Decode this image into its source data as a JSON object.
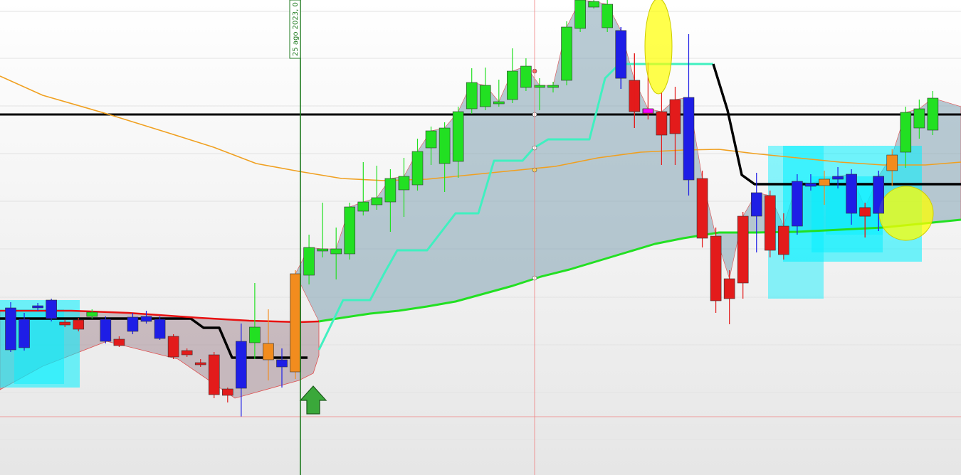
{
  "chart_data": {
    "type": "candlestick",
    "title": "",
    "xlabel": "",
    "ylabel": "",
    "grid": true,
    "legend": "none",
    "ylim": [
      0,
      668
    ],
    "date_marker": {
      "label": "25 ago 2023, 0",
      "index": 19
    },
    "candles": [
      {
        "i": 0,
        "o": 433,
        "c": 492,
        "h": 425,
        "l": 495,
        "color": "#1e1ee6"
      },
      {
        "i": 1,
        "o": 449,
        "c": 489,
        "h": 440,
        "l": 493,
        "color": "#1e1ee6"
      },
      {
        "i": 2,
        "o": 430,
        "c": 433,
        "h": 426,
        "l": 437,
        "color": "#1e1ee6"
      },
      {
        "i": 3,
        "o": 422,
        "c": 448,
        "h": 420,
        "l": 452,
        "color": "#1e1ee6"
      },
      {
        "i": 4,
        "o": 453,
        "c": 457,
        "h": 450,
        "l": 460,
        "color": "#e31b1b"
      },
      {
        "i": 5,
        "o": 450,
        "c": 463,
        "h": 447,
        "l": 466,
        "color": "#e31b1b"
      },
      {
        "i": 6,
        "o": 445,
        "c": 439,
        "h": 435,
        "l": 448,
        "color": "#22e022"
      },
      {
        "i": 7,
        "o": 449,
        "c": 480,
        "h": 445,
        "l": 483,
        "color": "#1e1ee6"
      },
      {
        "i": 8,
        "o": 477,
        "c": 486,
        "h": 473,
        "l": 488,
        "color": "#e31b1b"
      },
      {
        "i": 9,
        "o": 446,
        "c": 466,
        "h": 440,
        "l": 470,
        "color": "#1e1ee6"
      },
      {
        "i": 10,
        "o": 445,
        "c": 452,
        "h": 437,
        "l": 455,
        "color": "#1e1ee6"
      },
      {
        "i": 11,
        "o": 449,
        "c": 476,
        "h": 445,
        "l": 478,
        "color": "#1e1ee6"
      },
      {
        "i": 12,
        "o": 473,
        "c": 502,
        "h": 470,
        "l": 505,
        "color": "#e31b1b"
      },
      {
        "i": 13,
        "o": 493,
        "c": 499,
        "h": 490,
        "l": 502,
        "color": "#e31b1b"
      },
      {
        "i": 14,
        "o": 510,
        "c": 513,
        "h": 505,
        "l": 516,
        "color": "#e31b1b"
      },
      {
        "i": 15,
        "o": 499,
        "c": 555,
        "h": 495,
        "l": 560,
        "color": "#e31b1b"
      },
      {
        "i": 16,
        "o": 547,
        "c": 556,
        "h": 545,
        "l": 566,
        "color": "#e31b1b"
      },
      {
        "i": 17,
        "o": 480,
        "c": 546,
        "h": 455,
        "l": 586,
        "color": "#1e1ee6"
      },
      {
        "i": 18,
        "o": 482,
        "c": 460,
        "h": 398,
        "l": 505,
        "color": "#22e022"
      },
      {
        "i": 19,
        "o": 483,
        "c": 506,
        "h": 435,
        "l": 535,
        "color": "#f28c1e"
      },
      {
        "i": 20,
        "o": 506,
        "c": 516,
        "h": 490,
        "l": 545,
        "color": "#1e1ee6"
      },
      {
        "i": 21,
        "o": 523,
        "c": 385,
        "h": 380,
        "l": 533,
        "color": "#f28c1e"
      },
      {
        "i": 22,
        "o": 387,
        "c": 348,
        "h": 330,
        "l": 400,
        "color": "#22e022"
      },
      {
        "i": 23,
        "o": 352,
        "c": 350,
        "h": 285,
        "l": 362,
        "color": "#22e022"
      },
      {
        "i": 24,
        "o": 357,
        "c": 350,
        "h": 320,
        "l": 393,
        "color": "#22e022"
      },
      {
        "i": 25,
        "o": 357,
        "c": 291,
        "h": 285,
        "l": 365,
        "color": "#22e022"
      },
      {
        "i": 26,
        "o": 297,
        "c": 284,
        "h": 228,
        "l": 303,
        "color": "#22e022"
      },
      {
        "i": 27,
        "o": 288,
        "c": 278,
        "h": 233,
        "l": 295,
        "color": "#22e022"
      },
      {
        "i": 28,
        "o": 284,
        "c": 251,
        "h": 238,
        "l": 326,
        "color": "#22e022"
      },
      {
        "i": 29,
        "o": 267,
        "c": 248,
        "h": 222,
        "l": 305,
        "color": "#22e022"
      },
      {
        "i": 30,
        "o": 260,
        "c": 213,
        "h": 195,
        "l": 268,
        "color": "#22e022"
      },
      {
        "i": 31,
        "o": 208,
        "c": 184,
        "h": 178,
        "l": 232,
        "color": "#22e022"
      },
      {
        "i": 32,
        "o": 230,
        "c": 180,
        "h": 172,
        "l": 270,
        "color": "#22e022"
      },
      {
        "i": 33,
        "o": 227,
        "c": 157,
        "h": 150,
        "l": 250,
        "color": "#22e022"
      },
      {
        "i": 34,
        "o": 153,
        "c": 116,
        "h": 96,
        "l": 160,
        "color": "#22e022"
      },
      {
        "i": 35,
        "o": 150,
        "c": 120,
        "h": 95,
        "l": 155,
        "color": "#22e022"
      },
      {
        "i": 36,
        "o": 146,
        "c": 143,
        "h": 112,
        "l": 150,
        "color": "#22e022"
      },
      {
        "i": 37,
        "o": 140,
        "c": 100,
        "h": 68,
        "l": 145,
        "color": "#22e022"
      },
      {
        "i": 38,
        "o": 123,
        "c": 93,
        "h": 82,
        "l": 128,
        "color": "#22e022"
      },
      {
        "i": 39,
        "o": 123,
        "c": 120,
        "h": 110,
        "l": 155,
        "color": "#22e022"
      },
      {
        "i": 40,
        "o": 123,
        "c": 120,
        "h": 115,
        "l": 130,
        "color": "#22e022"
      },
      {
        "i": 41,
        "o": 113,
        "c": 38,
        "h": 30,
        "l": 120,
        "color": "#22e022"
      },
      {
        "i": 42,
        "o": 40,
        "c": 0,
        "h": 0,
        "l": 45,
        "color": "#22e022"
      },
      {
        "i": 43,
        "o": 10,
        "c": 2,
        "h": 0,
        "l": 12,
        "color": "#22e022"
      },
      {
        "i": 44,
        "o": 39,
        "c": 6,
        "h": 0,
        "l": 45,
        "color": "#22e022"
      },
      {
        "i": 45,
        "o": 43,
        "c": 110,
        "h": 38,
        "l": 125,
        "color": "#1e1ee6"
      },
      {
        "i": 46,
        "o": 113,
        "c": 157,
        "h": 75,
        "l": 180,
        "color": "#e31b1b"
      },
      {
        "i": 47,
        "o": 153,
        "c": 160,
        "h": 88,
        "l": 168,
        "color": "#e31b1b"
      },
      {
        "i": 48,
        "o": 157,
        "c": 190,
        "h": 130,
        "l": 232,
        "color": "#e31b1b"
      },
      {
        "i": 49,
        "o": 140,
        "c": 188,
        "h": 122,
        "l": 232,
        "color": "#e31b1b"
      },
      {
        "i": 50,
        "o": 137,
        "c": 253,
        "h": 48,
        "l": 275,
        "color": "#1e1ee6"
      },
      {
        "i": 51,
        "o": 251,
        "c": 335,
        "h": 240,
        "l": 348,
        "color": "#e31b1b"
      },
      {
        "i": 52,
        "o": 332,
        "c": 423,
        "h": 320,
        "l": 440,
        "color": "#e31b1b"
      },
      {
        "i": 53,
        "o": 392,
        "c": 420,
        "h": 380,
        "l": 456,
        "color": "#e31b1b"
      },
      {
        "i": 54,
        "o": 304,
        "c": 398,
        "h": 298,
        "l": 420,
        "color": "#e31b1b"
      },
      {
        "i": 55,
        "o": 271,
        "c": 304,
        "h": 243,
        "l": 355,
        "color": "#1e1ee6"
      },
      {
        "i": 56,
        "o": 275,
        "c": 352,
        "h": 268,
        "l": 362,
        "color": "#e31b1b"
      },
      {
        "i": 57,
        "o": 318,
        "c": 358,
        "h": 300,
        "l": 365,
        "color": "#e31b1b"
      },
      {
        "i": 58,
        "o": 255,
        "c": 318,
        "h": 245,
        "l": 330,
        "color": "#1e1ee6"
      },
      {
        "i": 59,
        "o": 258,
        "c": 262,
        "h": 245,
        "l": 268,
        "color": "#1e1ee6"
      },
      {
        "i": 60,
        "o": 252,
        "c": 261,
        "h": 240,
        "l": 288,
        "color": "#f28c1e"
      },
      {
        "i": 61,
        "o": 248,
        "c": 252,
        "h": 235,
        "l": 265,
        "color": "#1e1ee6"
      },
      {
        "i": 62,
        "o": 245,
        "c": 300,
        "h": 238,
        "l": 316,
        "color": "#1e1ee6"
      },
      {
        "i": 63,
        "o": 292,
        "c": 304,
        "h": 285,
        "l": 334,
        "color": "#e31b1b"
      },
      {
        "i": 64,
        "o": 248,
        "c": 300,
        "h": 240,
        "l": 325,
        "color": "#1e1ee6"
      },
      {
        "i": 65,
        "o": 218,
        "c": 240,
        "h": 210,
        "l": 262,
        "color": "#f28c1e"
      },
      {
        "i": 66,
        "o": 214,
        "c": 158,
        "h": 150,
        "l": 236,
        "color": "#22e022"
      },
      {
        "i": 67,
        "o": 180,
        "c": 153,
        "h": 140,
        "l": 195,
        "color": "#22e022"
      },
      {
        "i": 68,
        "o": 183,
        "c": 138,
        "h": 128,
        "l": 190,
        "color": "#22e022"
      }
    ],
    "series": [
      {
        "role": "ma-orange",
        "color": "#f0a020",
        "values": [
          [
            0,
            107
          ],
          [
            60,
            134
          ],
          [
            150,
            160
          ],
          [
            240,
            188
          ],
          [
            300,
            207
          ],
          [
            360,
            230
          ],
          [
            420,
            241
          ],
          [
            480,
            251
          ],
          [
            540,
            254
          ],
          [
            600,
            252
          ],
          [
            660,
            246
          ],
          [
            720,
            240
          ],
          [
            780,
            234
          ],
          [
            840,
            222
          ],
          [
            900,
            214
          ],
          [
            960,
            211
          ],
          [
            1010,
            210
          ],
          [
            1060,
            216
          ],
          [
            1120,
            222
          ],
          [
            1180,
            228
          ],
          [
            1240,
            232
          ],
          [
            1300,
            232
          ],
          [
            1350,
            228
          ]
        ]
      },
      {
        "role": "ma-green",
        "color": "#22e022",
        "values": [
          [
            448,
            452
          ],
          [
            480,
            447
          ],
          [
            520,
            441
          ],
          [
            560,
            437
          ],
          [
            600,
            431
          ],
          [
            640,
            424
          ],
          [
            680,
            413
          ],
          [
            720,
            402
          ],
          [
            760,
            389
          ],
          [
            800,
            379
          ],
          [
            840,
            367
          ],
          [
            880,
            355
          ],
          [
            920,
            343
          ],
          [
            960,
            335
          ],
          [
            1010,
            327
          ],
          [
            1060,
            327
          ],
          [
            1120,
            326
          ],
          [
            1180,
            323
          ],
          [
            1240,
            320
          ],
          [
            1300,
            314
          ],
          [
            1350,
            309
          ]
        ]
      },
      {
        "role": "trail-aqua",
        "color": "#40f0c0",
        "values": [
          [
            448,
            492
          ],
          [
            482,
            422
          ],
          [
            520,
            422
          ],
          [
            540,
            384
          ],
          [
            558,
            352
          ],
          [
            600,
            352
          ],
          [
            640,
            300
          ],
          [
            672,
            300
          ],
          [
            694,
            226
          ],
          [
            734,
            226
          ],
          [
            750,
            208
          ],
          [
            770,
            196
          ],
          [
            828,
            196
          ],
          [
            850,
            110
          ],
          [
            870,
            90
          ],
          [
            1002,
            90
          ]
        ]
      },
      {
        "role": "trail-black-left",
        "color": "#000000",
        "values": [
          [
            0,
            448
          ],
          [
            268,
            448
          ],
          [
            286,
            461
          ],
          [
            308,
            461
          ],
          [
            326,
            503
          ],
          [
            432,
            503
          ]
        ]
      },
      {
        "role": "trail-black-right",
        "color": "#000000",
        "values": [
          [
            1002,
            90
          ],
          [
            1022,
            155
          ],
          [
            1042,
            246
          ],
          [
            1060,
            259
          ],
          [
            1350,
            259
          ]
        ]
      },
      {
        "role": "baseline-red",
        "color": "#e81010",
        "values": [
          [
            0,
            437
          ],
          [
            100,
            437
          ],
          [
            180,
            440
          ],
          [
            280,
            447
          ],
          [
            350,
            451
          ],
          [
            420,
            453
          ],
          [
            448,
            452
          ]
        ]
      }
    ],
    "levels": [
      {
        "role": "black-hline",
        "value": 161,
        "color": "#000000"
      },
      {
        "role": "crosshair-h",
        "value": 586,
        "color": "#f08080"
      }
    ]
  },
  "colors": {
    "bullish": "#22e022",
    "bearish": "#e31b1b",
    "neutral_blue": "#1e1ee6",
    "signal_orange": "#f28c1e",
    "cloud_fill": "#8aa8b8",
    "cyan_zone": "#00f0ff",
    "highlight_yellow": "#ffff00",
    "marker_arrow": "#3aa83a",
    "date_line": "#1f7a1f"
  }
}
